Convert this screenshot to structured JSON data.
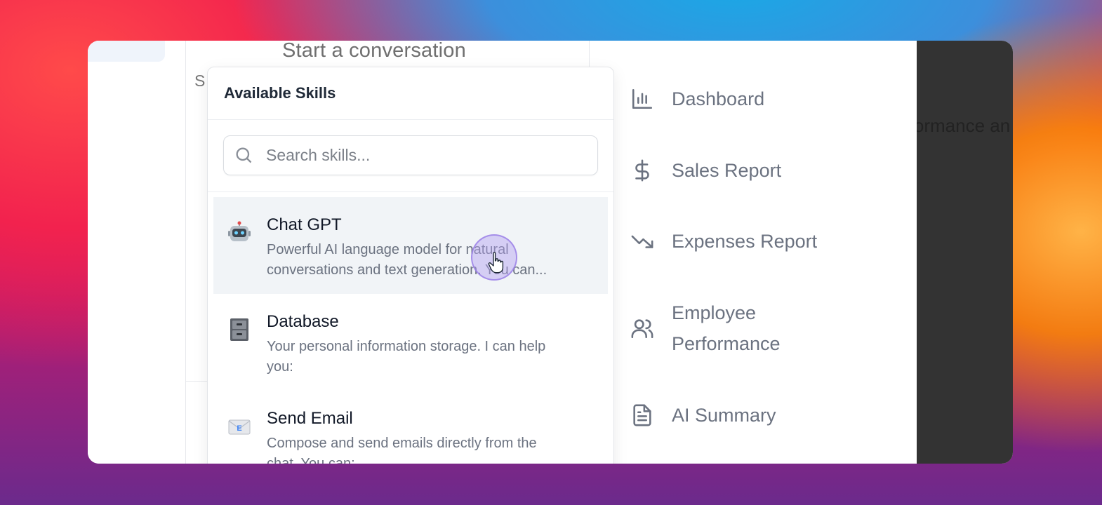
{
  "conversation": {
    "title": "Start a conversation",
    "partial_label": "S"
  },
  "skills_panel": {
    "title": "Available Skills",
    "search_placeholder": "Search skills...",
    "skills": [
      {
        "icon": "robot-icon",
        "title": "Chat GPT",
        "description": "Powerful AI language model for natural\nconversations and text generation. You can..."
      },
      {
        "icon": "file-cabinet-icon",
        "title": "Database",
        "description": "Your personal information storage. I can help\nyou:"
      },
      {
        "icon": "envelope-icon",
        "title": "Send Email",
        "description": "Compose and send emails directly from the\nchat. You can:"
      }
    ]
  },
  "reports": {
    "items": [
      {
        "icon": "bar-chart-icon",
        "label": "Dashboard"
      },
      {
        "icon": "dollar-icon",
        "label": "Sales Report"
      },
      {
        "icon": "trending-down-icon",
        "label": "Expenses Report"
      },
      {
        "icon": "users-icon",
        "label": "Employee\nPerformance"
      },
      {
        "icon": "document-icon",
        "label": "AI Summary"
      }
    ]
  },
  "dark_pane": {
    "partial_text": "rformance an"
  }
}
